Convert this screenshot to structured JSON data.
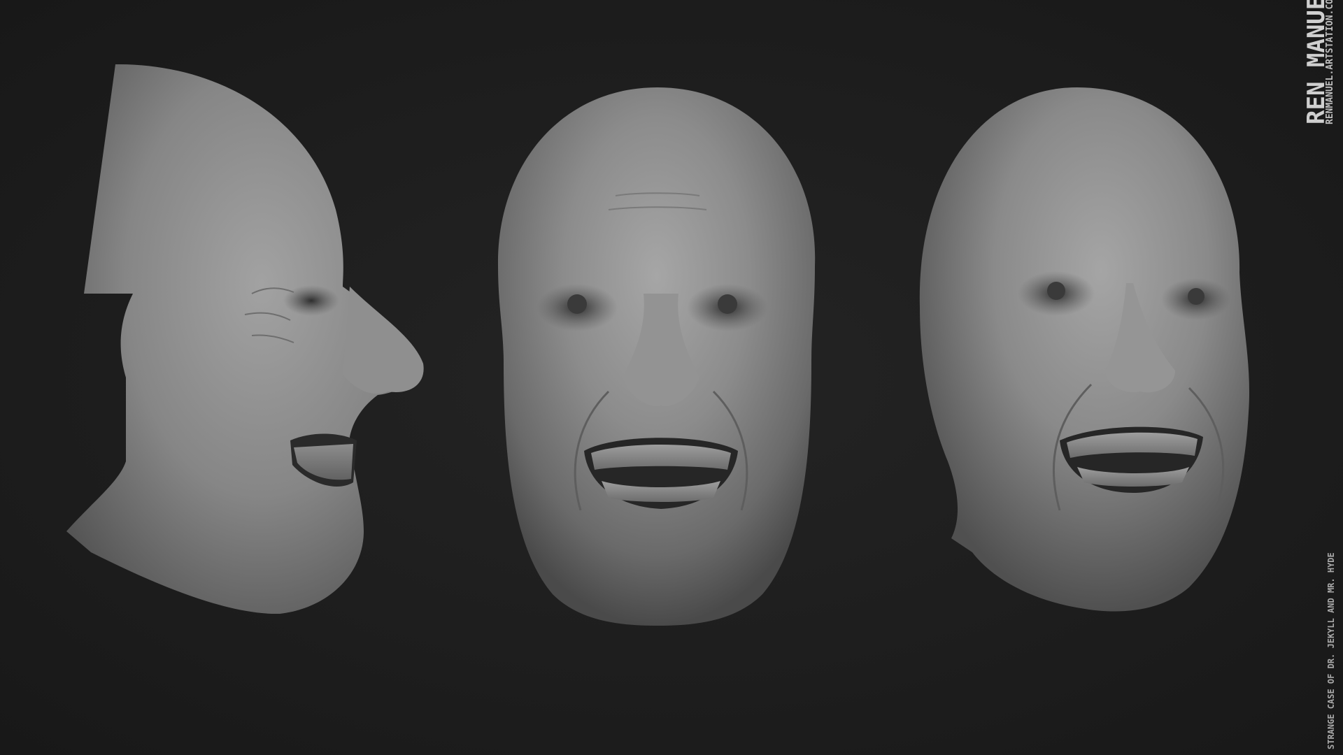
{
  "artwork": {
    "artist_name": "Ren Manuel",
    "artist_site": "RENMANUEL.ARTSTATION.COM",
    "project_title": "Strange case of Dr. Jekyll and Mr. Hyde"
  },
  "views": [
    {
      "id": "profile",
      "description_icon": "head-side-view"
    },
    {
      "id": "front",
      "description_icon": "head-front-view"
    },
    {
      "id": "three-quarter",
      "description_icon": "head-three-quarter-view"
    }
  ],
  "colors": {
    "background": "#1c1c1c",
    "clay": "#8a8a8a",
    "text": "#cfcfcf"
  }
}
